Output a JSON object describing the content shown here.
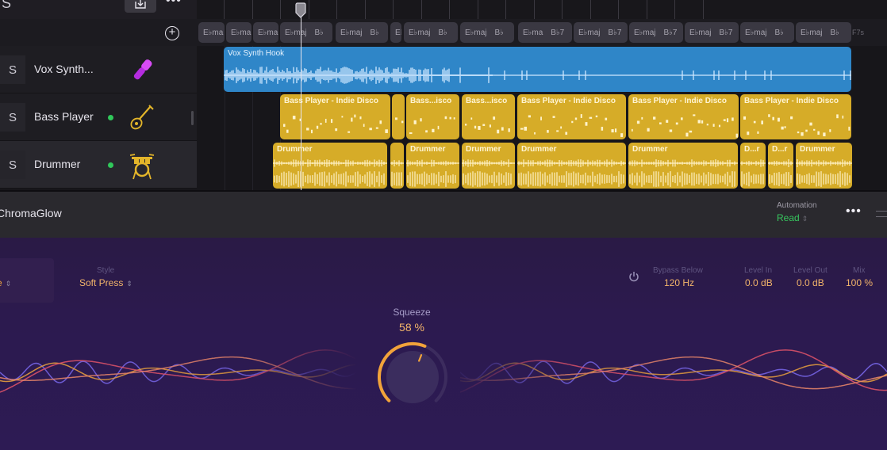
{
  "topbar": {
    "solo_label": "S",
    "download_icon": "tray-arrow-down-icon",
    "more_icon": "ellipsis-icon"
  },
  "chord_track": {
    "add_icon": "plus-circle-icon",
    "chords": [
      {
        "labels": [
          "E♭ma"
        ]
      },
      {
        "labels": [
          "E♭ma"
        ]
      },
      {
        "labels": [
          "E♭ma"
        ]
      },
      {
        "labels": [
          "E♭maj",
          "B♭"
        ]
      },
      {
        "labels": [
          "E♭maj",
          "B♭"
        ]
      },
      {
        "labels": [
          "E♭"
        ]
      },
      {
        "labels": [
          "E♭maj",
          "B♭"
        ]
      },
      {
        "labels": [
          "E♭maj",
          "B♭"
        ]
      },
      {
        "labels": [
          "E♭ma",
          "B♭7"
        ]
      },
      {
        "labels": [
          "E♭maj",
          "B♭7"
        ]
      },
      {
        "labels": [
          "E♭maj",
          "B♭7"
        ]
      },
      {
        "labels": [
          "E♭maj",
          "B♭7"
        ]
      },
      {
        "labels": [
          "E♭maj",
          "B♭"
        ]
      },
      {
        "labels": [
          "E♭maj",
          "B♭"
        ]
      }
    ],
    "trailing_label": "F7s"
  },
  "tracks": [
    {
      "solo": "S",
      "name": "Vox Synth...",
      "icon": "microphone-icon",
      "icon_color": "#c23be8",
      "active": false,
      "regions": [
        {
          "label": "Vox Synth Hook",
          "type": "audio"
        }
      ]
    },
    {
      "solo": "S",
      "name": "Bass Player",
      "icon": "bass-guitar-icon",
      "icon_color": "#e3b52a",
      "active": true,
      "regions": [
        {
          "label": "Bass Player - Indie Disco",
          "type": "midi"
        },
        {
          "label": "",
          "type": "midi"
        },
        {
          "label": "Bass...isco",
          "type": "midi"
        },
        {
          "label": "Bass...isco",
          "type": "midi"
        },
        {
          "label": "Bass Player - Indie Disco",
          "type": "midi"
        },
        {
          "label": "Bass Player - Indie Disco",
          "type": "midi"
        },
        {
          "label": "Bass Player - Indie Disco",
          "type": "midi"
        }
      ]
    },
    {
      "solo": "S",
      "name": "Drummer",
      "icon": "drum-kit-icon",
      "icon_color": "#e3b52a",
      "active": true,
      "regions": [
        {
          "label": "Drummer",
          "type": "midi"
        },
        {
          "label": "",
          "type": "midi"
        },
        {
          "label": "Drummer",
          "type": "midi"
        },
        {
          "label": "Drummer",
          "type": "midi"
        },
        {
          "label": "Drummer",
          "type": "midi"
        },
        {
          "label": "Drummer",
          "type": "midi"
        },
        {
          "label": "D...r",
          "type": "midi"
        },
        {
          "label": "D...r",
          "type": "midi"
        },
        {
          "label": "Drummer",
          "type": "midi"
        }
      ]
    }
  ],
  "plugin": {
    "name": "ChromaGlow",
    "automation_label": "Automation",
    "automation_value": "Read",
    "more_icon": "ellipsis-icon",
    "mode_value": "e",
    "style_label": "Style",
    "style_value": "Soft Press",
    "bypass_label": "Bypass Below",
    "bypass_value": "120 Hz",
    "level_in_label": "Level In",
    "level_in_value": "0.0 dB",
    "level_out_label": "Level Out",
    "level_out_value": "0.0 dB",
    "mix_label": "Mix",
    "mix_value": "100 %",
    "knob_label": "Squeeze",
    "knob_value": "58 %",
    "knob_fraction": 0.58
  },
  "colors": {
    "audio_region": "#2f86c8",
    "midi_region": "#d6ac28",
    "accent_orange": "#f0a43c",
    "automation_green": "#37c55e"
  }
}
